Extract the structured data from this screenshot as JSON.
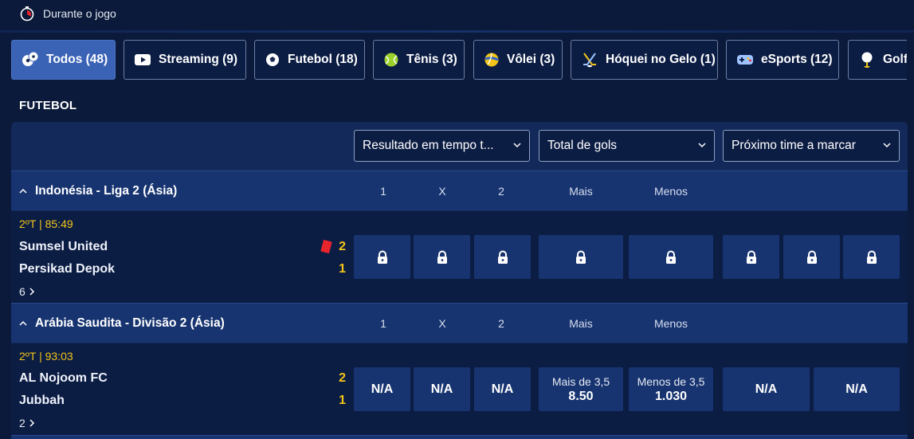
{
  "header": {
    "title": "Durante o jogo",
    "icon": "stopwatch-icon"
  },
  "sports_tabs": [
    {
      "label": "Todos (48)",
      "icon": "soccer-balls-icon",
      "active": true
    },
    {
      "label": "Streaming (9)",
      "icon": "play-icon",
      "active": false
    },
    {
      "label": "Futebol (18)",
      "icon": "soccer-ball-icon",
      "active": false
    },
    {
      "label": "Tênis (3)",
      "icon": "tennis-ball-icon",
      "active": false
    },
    {
      "label": "Vôlei (3)",
      "icon": "volleyball-icon",
      "active": false
    },
    {
      "label": "Hóquei no Gelo (1)",
      "icon": "hockey-sticks-icon",
      "active": false
    },
    {
      "label": "eSports (12)",
      "icon": "gamepad-icon",
      "active": false
    },
    {
      "label": "Golfe",
      "icon": "golf-ball-icon",
      "active": false
    }
  ],
  "section": {
    "title": "FUTEBOL"
  },
  "market_selects": [
    {
      "value": "Resultado em tempo t..."
    },
    {
      "value": "Total de gols"
    },
    {
      "value": "Próximo time a marcar"
    }
  ],
  "leagues": [
    {
      "name": "Indonésia - Liga 2 (Ásia)",
      "columns": [
        "1",
        "X",
        "2",
        "Mais",
        "Menos"
      ],
      "match": {
        "period": "2ºT",
        "clock": "85:49",
        "home": {
          "name": "Sumsel United",
          "score": "2",
          "red_cards": 1
        },
        "away": {
          "name": "Persikad Depok",
          "score": "1"
        },
        "more_markets": "6",
        "odds_locked": true
      }
    },
    {
      "name": "Arábia Saudita - Divisão 2 (Ásia)",
      "columns": [
        "1",
        "X",
        "2",
        "Mais",
        "Menos"
      ],
      "match": {
        "period": "2ºT",
        "clock": "93:03",
        "home": {
          "name": "AL Nojoom FC",
          "score": "2"
        },
        "away": {
          "name": "Jubbah",
          "score": "1"
        },
        "more_markets": "2",
        "odds": [
          {
            "value": "N/A"
          },
          {
            "value": "N/A"
          },
          {
            "value": "N/A"
          },
          {
            "label": "Mais de 3,5",
            "value": "8.50"
          },
          {
            "label": "Menos de 3,5",
            "value": "1.030"
          },
          {
            "value": "N/A"
          },
          {
            "value": "N/A"
          }
        ]
      }
    }
  ],
  "colors": {
    "accent_active": "#3b63b5",
    "score_yellow": "#f2c418",
    "panel": "#12295a",
    "red_card": "#e8242c"
  }
}
